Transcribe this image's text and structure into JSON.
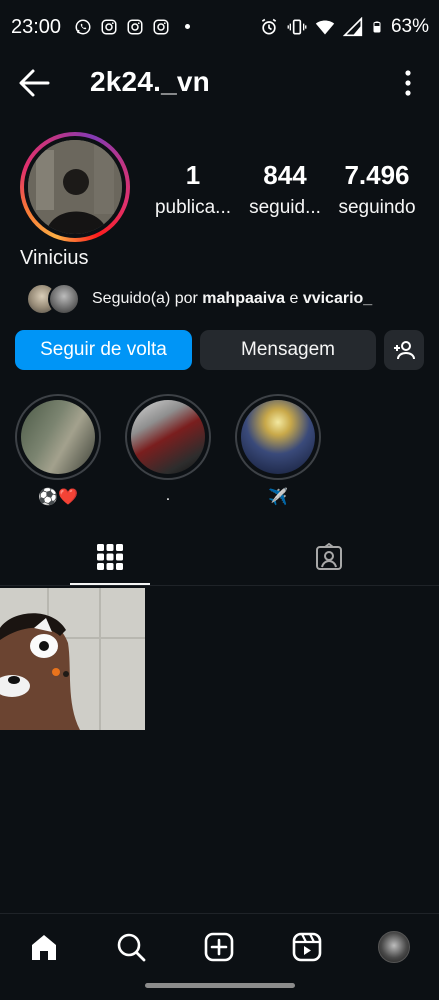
{
  "status_bar": {
    "time": "23:00",
    "battery": "63%",
    "app_icons": [
      "whatsapp-icon",
      "instagram-icon",
      "instagram-icon",
      "instagram-icon"
    ],
    "system_icons": [
      "alarm-icon",
      "vibrate-icon",
      "wifi-icon",
      "signal-icon",
      "battery-icon"
    ]
  },
  "header": {
    "username": "2k24._vn"
  },
  "profile": {
    "display_name": "Vinicius",
    "stats": [
      {
        "value": "1",
        "label": "publica..."
      },
      {
        "value": "844",
        "label": "seguid..."
      },
      {
        "value": "7.496",
        "label": "seguindo"
      }
    ],
    "followed_by": {
      "prefix": "Seguido(a) por ",
      "user1": "mahpaaiva",
      "connector": " e ",
      "user2": "vvicario_"
    }
  },
  "actions": {
    "follow_back": "Seguir de volta",
    "message": "Mensagem"
  },
  "highlights": [
    {
      "label": "⚽❤️"
    },
    {
      "label": "."
    },
    {
      "label": "✈️"
    }
  ],
  "colors": {
    "background": "#0c1014",
    "primary_button": "#0095f6",
    "secondary_button": "#25292e"
  },
  "tabs": [
    "grid-icon",
    "tagged-icon"
  ],
  "nav": [
    "home-icon",
    "search-icon",
    "create-icon",
    "reels-icon",
    "profile-avatar"
  ]
}
